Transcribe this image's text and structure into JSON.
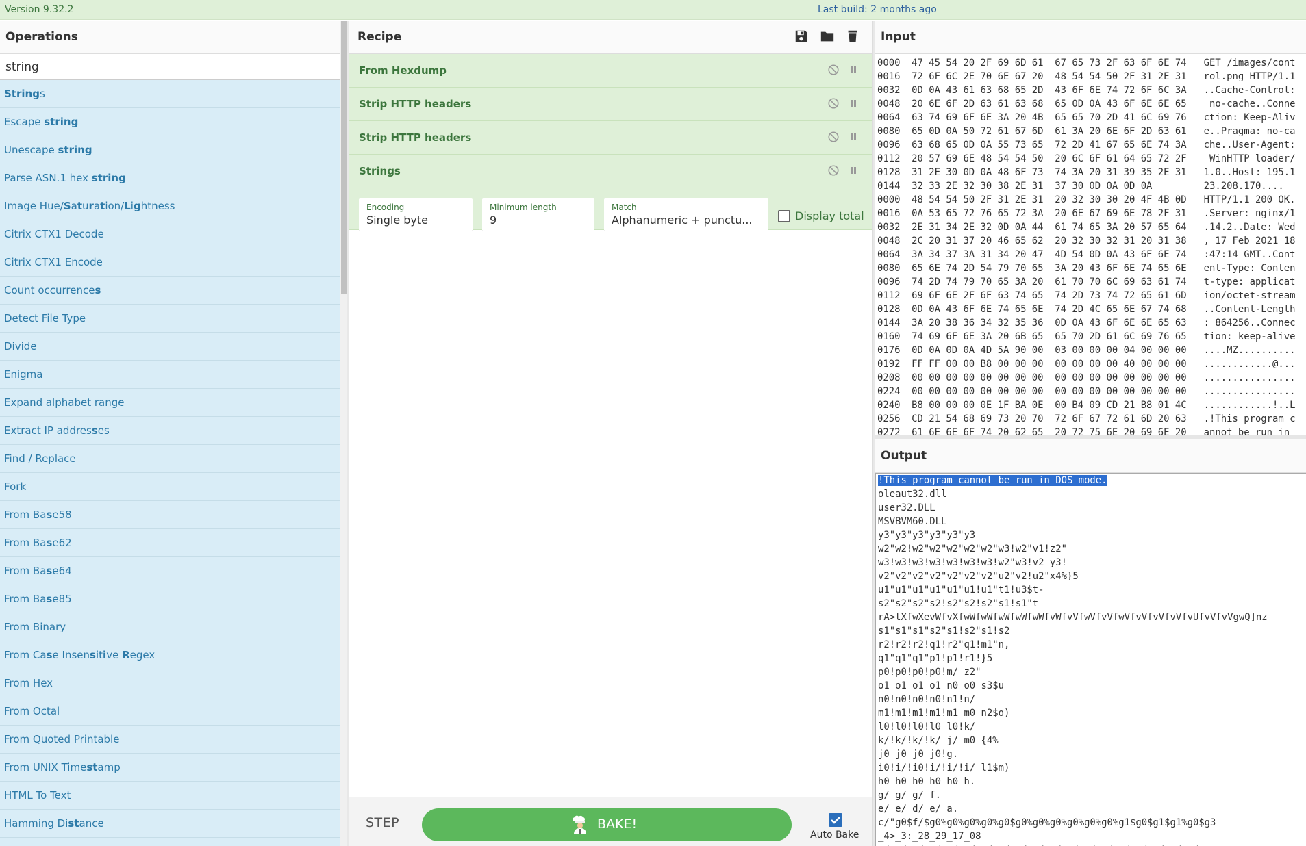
{
  "topbar": {
    "version": "Version 9.32.2",
    "last_build": "Last build: 2 months ago"
  },
  "operations": {
    "title": "Operations",
    "search_value": "string",
    "items": [
      {
        "label": "Strings",
        "highlight": [
          [
            0,
            6
          ]
        ]
      },
      {
        "label": "Escape string",
        "highlight": [
          [
            7,
            13
          ]
        ]
      },
      {
        "label": "Unescape string",
        "highlight": [
          [
            9,
            15
          ]
        ]
      },
      {
        "label": "Parse ASN.1 hex string",
        "highlight": [
          [
            16,
            22
          ]
        ]
      },
      {
        "label": "Image Hue/Saturation/Lightness",
        "highlight": [
          [
            10,
            11
          ],
          [
            12,
            13
          ],
          [
            14,
            15
          ],
          [
            16,
            17
          ],
          [
            21,
            22
          ],
          [
            23,
            24
          ]
        ]
      },
      {
        "label": "Citrix CTX1 Decode",
        "highlight": []
      },
      {
        "label": "Citrix CTX1 Encode",
        "highlight": []
      },
      {
        "label": "Count occurrences",
        "highlight": [
          [
            16,
            17
          ]
        ]
      },
      {
        "label": "Detect File Type",
        "highlight": []
      },
      {
        "label": "Divide",
        "highlight": []
      },
      {
        "label": "Enigma",
        "highlight": []
      },
      {
        "label": "Expand alphabet range",
        "highlight": []
      },
      {
        "label": "Extract IP addresses",
        "highlight": [
          [
            17,
            18
          ]
        ]
      },
      {
        "label": "Find / Replace",
        "highlight": []
      },
      {
        "label": "Fork",
        "highlight": []
      },
      {
        "label": "From Base58",
        "highlight": [
          [
            7,
            8
          ]
        ]
      },
      {
        "label": "From Base62",
        "highlight": [
          [
            7,
            8
          ]
        ]
      },
      {
        "label": "From Base64",
        "highlight": [
          [
            7,
            8
          ]
        ]
      },
      {
        "label": "From Base85",
        "highlight": [
          [
            7,
            8
          ]
        ]
      },
      {
        "label": "From Binary",
        "highlight": []
      },
      {
        "label": "From Case Insensitive Regex",
        "highlight": [
          [
            7,
            8
          ],
          [
            15,
            16
          ],
          [
            18,
            19
          ],
          [
            22,
            23
          ]
        ]
      },
      {
        "label": "From Hex",
        "highlight": []
      },
      {
        "label": "From Octal",
        "highlight": []
      },
      {
        "label": "From Quoted Printable",
        "highlight": []
      },
      {
        "label": "From UNIX Timestamp",
        "highlight": [
          [
            14,
            16
          ]
        ]
      },
      {
        "label": "HTML To Text",
        "highlight": []
      },
      {
        "label": "Hamming Distance",
        "highlight": [
          [
            10,
            12
          ]
        ]
      }
    ]
  },
  "recipe": {
    "title": "Recipe",
    "steps": [
      "From Hexdump",
      "Strip HTTP headers",
      "Strip HTTP headers",
      "Strings"
    ],
    "args": {
      "encoding": {
        "label": "Encoding",
        "value": "Single byte"
      },
      "min_length": {
        "label": "Minimum length",
        "value": "9"
      },
      "match": {
        "label": "Match",
        "value": "Alphanumeric + punctu..."
      },
      "display_total": {
        "label": "Display total",
        "checked": false
      }
    }
  },
  "controls": {
    "step_label": "STEP",
    "bake_label": "BAKE!",
    "auto_bake_label": "Auto Bake",
    "auto_bake_checked": true
  },
  "input": {
    "title": "Input",
    "lines": [
      "0000  47 45 54 20 2F 69 6D 61  67 65 73 2F 63 6F 6E 74   GET /images/cont",
      "0016  72 6F 6C 2E 70 6E 67 20  48 54 54 50 2F 31 2E 31   rol.png HTTP/1.1",
      "0032  0D 0A 43 61 63 68 65 2D  43 6F 6E 74 72 6F 6C 3A   ..Cache-Control:",
      "0048  20 6E 6F 2D 63 61 63 68  65 0D 0A 43 6F 6E 6E 65    no-cache..Conne",
      "0064  63 74 69 6F 6E 3A 20 4B  65 65 70 2D 41 6C 69 76   ction: Keep-Aliv",
      "0080  65 0D 0A 50 72 61 67 6D  61 3A 20 6E 6F 2D 63 61   e..Pragma: no-ca",
      "0096  63 68 65 0D 0A 55 73 65  72 2D 41 67 65 6E 74 3A   che..User-Agent:",
      "0112  20 57 69 6E 48 54 54 50  20 6C 6F 61 64 65 72 2F    WinHTTP loader/",
      "0128  31 2E 30 0D 0A 48 6F 73  74 3A 20 31 39 35 2E 31   1.0..Host: 195.1",
      "0144  32 33 2E 32 30 38 2E 31  37 30 0D 0A 0D 0A         23.208.170....",
      "0000  48 54 54 50 2F 31 2E 31  20 32 30 30 20 4F 4B 0D   HTTP/1.1 200 OK.",
      "0016  0A 53 65 72 76 65 72 3A  20 6E 67 69 6E 78 2F 31   .Server: nginx/1",
      "0032  2E 31 34 2E 32 0D 0A 44  61 74 65 3A 20 57 65 64   .14.2..Date: Wed",
      "0048  2C 20 31 37 20 46 65 62  20 32 30 32 31 20 31 38   , 17 Feb 2021 18",
      "0064  3A 34 37 3A 31 34 20 47  4D 54 0D 0A 43 6F 6E 74   :47:14 GMT..Cont",
      "0080  65 6E 74 2D 54 79 70 65  3A 20 43 6F 6E 74 65 6E   ent-Type: Conten",
      "0096  74 2D 74 79 70 65 3A 20  61 70 70 6C 69 63 61 74   t-type: applicat",
      "0112  69 6F 6E 2F 6F 63 74 65  74 2D 73 74 72 65 61 6D   ion/octet-stream",
      "0128  0D 0A 43 6F 6E 74 65 6E  74 2D 4C 65 6E 67 74 68   ..Content-Length",
      "0144  3A 20 38 36 34 32 35 36  0D 0A 43 6F 6E 6E 65 63   : 864256..Connec",
      "0160  74 69 6F 6E 3A 20 6B 65  65 70 2D 61 6C 69 76 65   tion: keep-alive",
      "0176  0D 0A 0D 0A 4D 5A 90 00  03 00 00 00 04 00 00 00   ....MZ..........",
      "0192  FF FF 00 00 B8 00 00 00  00 00 00 00 40 00 00 00   ............@...",
      "0208  00 00 00 00 00 00 00 00  00 00 00 00 00 00 00 00   ................",
      "0224  00 00 00 00 00 00 00 00  00 00 00 00 00 00 00 00   ................",
      "0240  B8 00 00 00 0E 1F BA 0E  00 B4 09 CD 21 B8 01 4C   ............!..L",
      "0256  CD 21 54 68 69 73 20 70  72 6F 67 72 61 6D 20 63   .!This program c",
      "0272  61 6E 6E 6F 74 20 62 65  20 72 75 6E 20 69 6E 20   annot be run in "
    ]
  },
  "output": {
    "title": "Output",
    "selected_line": "!This program cannot be run in DOS mode.",
    "lines": [
      "oleaut32.dll",
      "user32.DLL",
      "MSVBVM60.DLL",
      "y3\"y3\"y3\"y3\"y3\"y3",
      "w2\"w2!w2\"w2\"w2\"w2\"w2\"w3!w2\"v1!z2\"",
      "w3!w3!w3!w3!w3!w3!w3!w2\"w3!v2 y3!",
      "v2\"v2\"v2\"v2\"v2\"v2\"v2\"u2\"v2!u2\"x4%}5",
      "u1\"u1\"u1\"u1\"u1\"u1!u1\"t1!u3$t-",
      "s2\"s2\"s2\"s2!s2\"s2!s2\"s1!s1\"t",
      "rA>tXfwXevWfvXfwWfwWfwWfwWfwWfvWfvVfwVfvVfwVfvVfvVfvVfvUfvVfvVgwQ]nz",
      "s1\"s1\"s1\"s2\"s1!s2\"s1!s2",
      "r2!r2!r2!q1!r2\"q1!m1\"n,",
      "q1\"q1\"q1\"p1!p1!r1!}5",
      "p0!p0!p0!p0!m/ z2\"",
      "o1 o1 o1 o1 n0 o0 s3$u",
      "n0!n0!n0!n0!n1!n/",
      "m1!m1!m1!m1!m1 m0 n2$o)",
      "l0!l0!l0!l0 l0!k/",
      "k/!k/!k/!k/ j/ m0 {4%",
      "j0 j0 j0 j0!g.",
      "i0!i/!i0!i/!i/!i/ l1$m)",
      "h0 h0 h0 h0 h0 h.",
      "g/ g/ g/ f.",
      "e/ e/ d/ e/ a.",
      "c/\"g0$f/$g0%g0%g0%g0%g0$g0%g0%g0%g0%g0%g0%g1$g0$g1$g1%g0$g3",
      "_4>_3:_28_29_17_08",
      "e/ e/ e/ e/ e/ e/ e/ e/ e/ e/ e/ e/ e/ e/ e/ e/ e/ e/ e/"
    ]
  },
  "colors": {
    "accent_green": "#3c763d",
    "op_blue": "#2c7aa8",
    "bake_green": "#5cb85c",
    "selection": "#2d6ed0"
  },
  "icons": [
    "save-icon",
    "folder-icon",
    "trash-icon",
    "disable-icon",
    "breakpoint-icon",
    "chef-icon",
    "checkbox-icon"
  ]
}
